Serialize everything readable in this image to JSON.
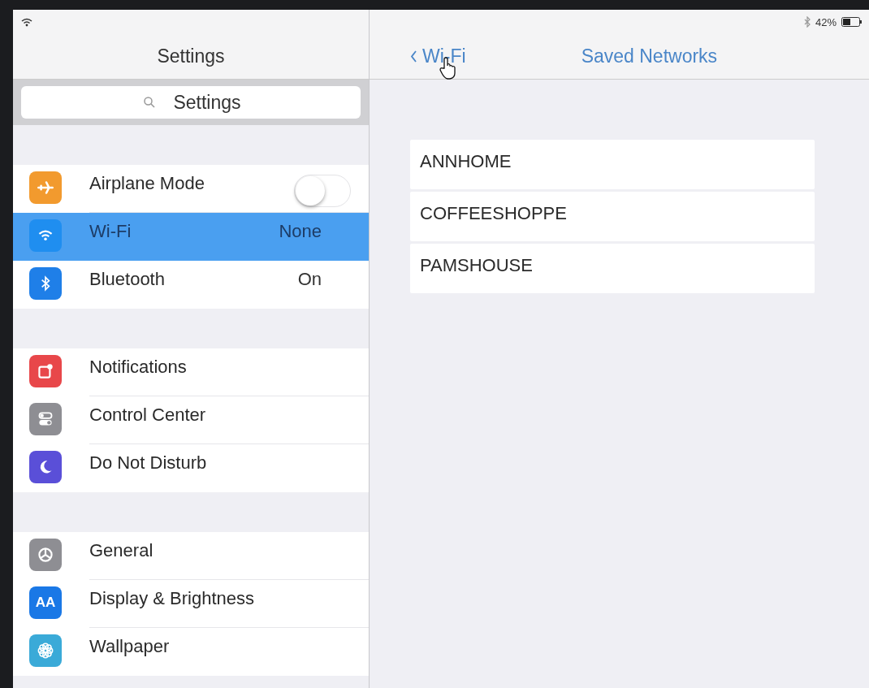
{
  "status_bar": {
    "battery": "42%"
  },
  "sidebar": {
    "title": "Settings",
    "search": {
      "placeholder": "Settings"
    },
    "groups": [
      [
        {
          "label": "Airplane Mode",
          "color": "#f29a2e",
          "kind": "toggle",
          "on": false,
          "selected": false
        },
        {
          "label": "Wi-Fi",
          "color": "#1f8ef0",
          "kind": "value",
          "value": "None",
          "selected": true
        },
        {
          "label": "Bluetooth",
          "color": "#1f7fe8",
          "kind": "value",
          "value": "On",
          "selected": false
        }
      ],
      [
        {
          "label": "Notifications",
          "color": "#e8474a",
          "kind": "plain",
          "selected": false
        },
        {
          "label": "Control Center",
          "color": "#8e8e93",
          "kind": "plain",
          "selected": false
        },
        {
          "label": "Do Not Disturb",
          "color": "#5a4fd8",
          "kind": "plain",
          "selected": false
        }
      ],
      [
        {
          "label": "General",
          "color": "#8e8e93",
          "kind": "plain",
          "selected": false
        },
        {
          "label": "Display & Brightness",
          "color": "#1a78e6",
          "kind": "plain",
          "selected": false,
          "icon_label": "AA"
        },
        {
          "label": "Wallpaper",
          "color": "#3aaad8",
          "kind": "plain",
          "selected": false
        }
      ]
    ]
  },
  "detail": {
    "back": "Wi-Fi",
    "title": "Saved Networks",
    "networks": [
      "ANNHOME",
      "COFFEESHOPPE",
      "PAMSHOUSE"
    ]
  }
}
